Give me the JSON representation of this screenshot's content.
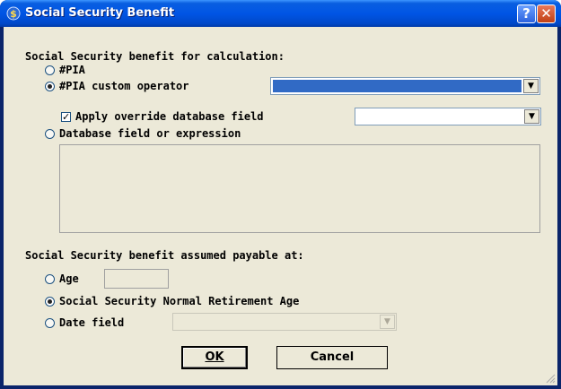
{
  "window": {
    "title": "Social Security Benefit",
    "help_label": "?",
    "close_label": "✕"
  },
  "calc_section": {
    "heading": "Social Security benefit for calculation:",
    "opt_pia": "#PIA",
    "opt_pia_custom": "#PIA custom operator",
    "apply_override": "Apply override database field",
    "opt_db_field": "Database field or expression",
    "selected": "#PIA custom operator",
    "apply_override_checked": true,
    "custom_operator_value": "",
    "override_field_value": "",
    "expression_value": ""
  },
  "payable_section": {
    "heading": "Social Security benefit assumed payable at:",
    "opt_age": "Age",
    "opt_normal_retirement": "Social Security Normal Retirement Age",
    "opt_date_field": "Date field",
    "selected": "Social Security Normal Retirement Age",
    "age_value": "",
    "date_field_value": ""
  },
  "buttons": {
    "ok_label": "OK",
    "cancel_label": "Cancel"
  },
  "icons": {
    "app": "dollar-icon",
    "dropdown": "chevron-down-icon",
    "check": "checkmark-icon"
  },
  "colors": {
    "titlebar": "#0055e5",
    "dialog_bg": "#ece9d8",
    "selection": "#316ac5",
    "close": "#c13f14"
  }
}
